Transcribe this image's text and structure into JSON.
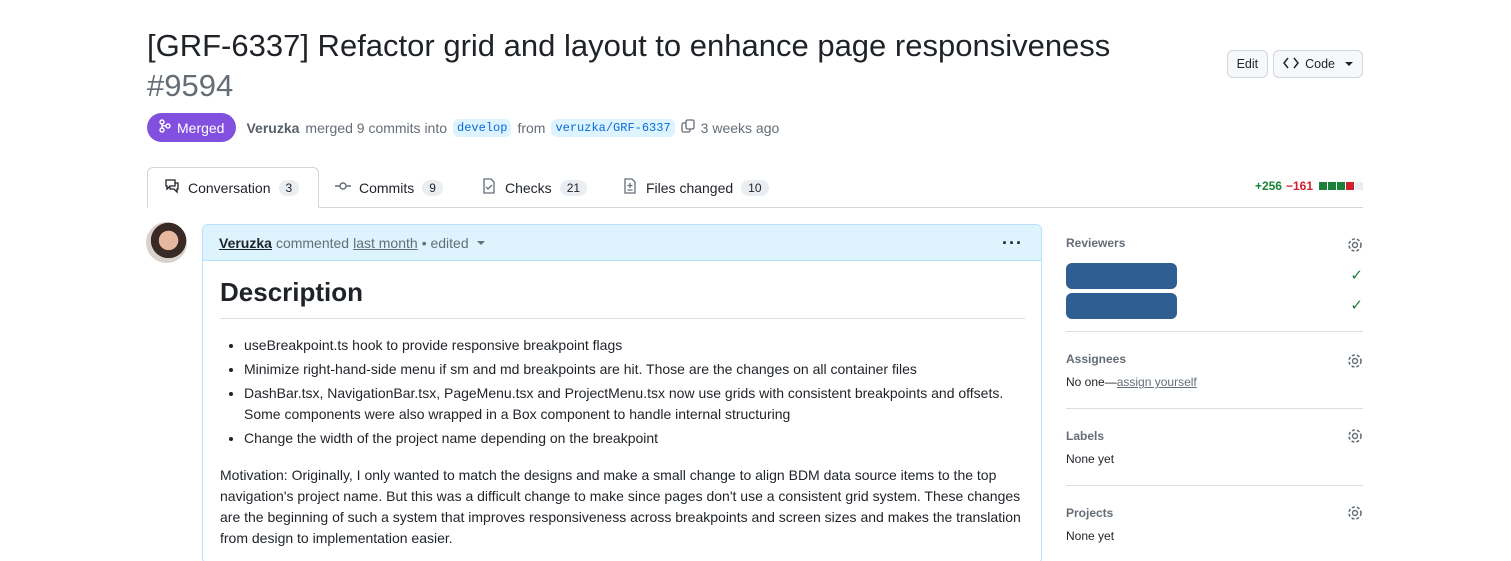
{
  "pr": {
    "title": "[GRF-6337] Refactor grid and layout to enhance page responsiveness",
    "number": "#9594",
    "status": "Merged",
    "author": "Veruzka",
    "merged_text": "merged 9 commits into",
    "base_branch": "develop",
    "from_text": "from",
    "head_branch": "veruzka/GRF-6337",
    "time": "3 weeks ago"
  },
  "buttons": {
    "edit": "Edit",
    "code": "Code"
  },
  "tabs": [
    {
      "label": "Conversation",
      "count": "3"
    },
    {
      "label": "Commits",
      "count": "9"
    },
    {
      "label": "Checks",
      "count": "21"
    },
    {
      "label": "Files changed",
      "count": "10"
    }
  ],
  "diffstat": {
    "additions": "+256",
    "deletions": "−161"
  },
  "comment": {
    "author": "Veruzka",
    "action": "commented",
    "time": "last month",
    "edited": "• edited",
    "heading": "Description",
    "bullets": [
      "useBreakpoint.ts hook to provide responsive breakpoint flags",
      "Minimize right-hand-side menu if sm and md breakpoints are hit. Those are the changes on all container files",
      "DashBar.tsx, NavigationBar.tsx, PageMenu.tsx and ProjectMenu.tsx now use grids with consistent breakpoints and offsets. Some components were also wrapped in a Box component to handle internal structuring",
      "Change the width of the project name depending on the breakpoint"
    ],
    "paragraph": "Motivation: Originally, I only wanted to match the designs and make a small change to align BDM data source items to the top navigation's project name. But this was a difficult change to make since pages don't use a consistent grid system. These changes are the beginning of such a system that improves responsiveness across breakpoints and screen sizes and makes the translation from design to implementation easier."
  },
  "sidebar": {
    "reviewers_label": "Reviewers",
    "assignees_label": "Assignees",
    "assignees_value": "No one—",
    "assign_link": "assign yourself",
    "labels_label": "Labels",
    "labels_value": "None yet",
    "projects_label": "Projects",
    "projects_value": "None yet"
  },
  "colors": {
    "merged": "#8250df",
    "accent": "#0969da",
    "add": "#1a7f37",
    "del": "#cf222e"
  }
}
